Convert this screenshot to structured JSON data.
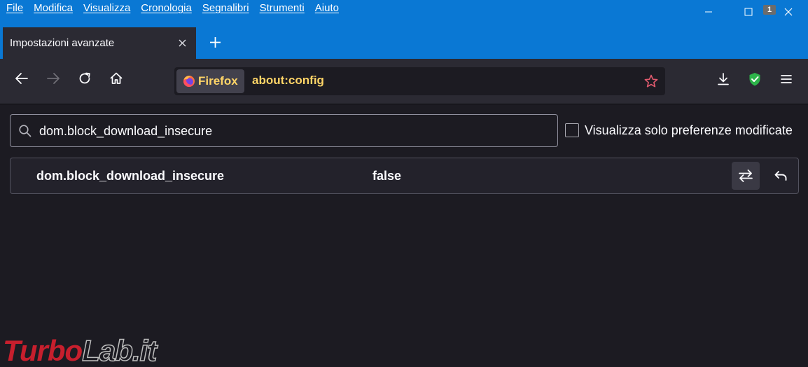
{
  "menu": [
    "File",
    "Modifica",
    "Visualizza",
    "Cronologia",
    "Segnalibri",
    "Strumenti",
    "Aiuto"
  ],
  "tab": {
    "title": "Impostazioni avanzate"
  },
  "urlbar": {
    "identity": "Firefox",
    "url": "about:config"
  },
  "extension_badge": "1",
  "search": {
    "value": "dom.block_download_insecure"
  },
  "filter": {
    "label": "Visualizza solo preferenze modificate",
    "checked": false
  },
  "preference": {
    "name": "dom.block_download_insecure",
    "value": "false"
  },
  "watermark": {
    "part1": "Turbo",
    "part2": "Lab.it"
  },
  "colors": {
    "titlebar": "#0a78d4",
    "toolbar": "#2b2a33",
    "page": "#1c1b22",
    "url_text": "#ffd567"
  }
}
